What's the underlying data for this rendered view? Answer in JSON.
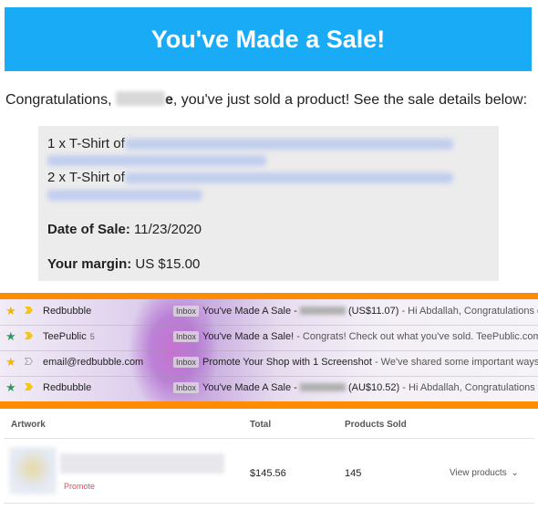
{
  "email": {
    "banner_title": "You've Made a Sale!",
    "greeting_prefix": "Congratulations,",
    "greeting_name_tail": "e",
    "greeting_suffix": ", you've just sold a product! See the sale details below:",
    "items": [
      {
        "label": "1 x T-Shirt of"
      },
      {
        "label": "2 x T-Shirt of"
      }
    ],
    "date_label": "Date of Sale:",
    "date_value": "11/23/2020",
    "margin_label": "Your margin:",
    "margin_value": "US $15.00"
  },
  "inbox": {
    "rows": [
      {
        "sender": "Redbubble",
        "count": "",
        "tag": "Inbox",
        "subject": "You've Made A Sale -",
        "amount": "(US$11.07)",
        "preview": " - Hi Abdallah, Congratulations on you",
        "starred": true,
        "star_color": "#f5b400"
      },
      {
        "sender": "TeePublic",
        "count": "5",
        "tag": "Inbox",
        "subject": "You've Made a Sale!",
        "amount": "",
        "preview": " - Congrats! Check out what you've sold. TeePublic.com You'v",
        "starred": true,
        "star_color": "#2f9b63"
      },
      {
        "sender": "email@redbubble.com",
        "count": "",
        "tag": "Inbox",
        "subject": "Promote Your Shop with 1 Screenshot",
        "amount": "",
        "preview": " - We've shared some important ways to pre",
        "starred": true,
        "star_color": "#f5b400"
      },
      {
        "sender": "Redbubble",
        "count": "",
        "tag": "Inbox",
        "subject": "You've Made A Sale -",
        "amount": "(AU$10.52)",
        "preview": " - Hi Abdallah, Congratulations on you",
        "starred": true,
        "star_color": "#2f9b63"
      }
    ],
    "accent_color": "#ff8c00"
  },
  "products": {
    "headers": {
      "artwork": "Artwork",
      "total": "Total",
      "sold": "Products Sold"
    },
    "row": {
      "promote": "Promote",
      "total": "$145.56",
      "sold": "145",
      "view": "View products"
    }
  }
}
